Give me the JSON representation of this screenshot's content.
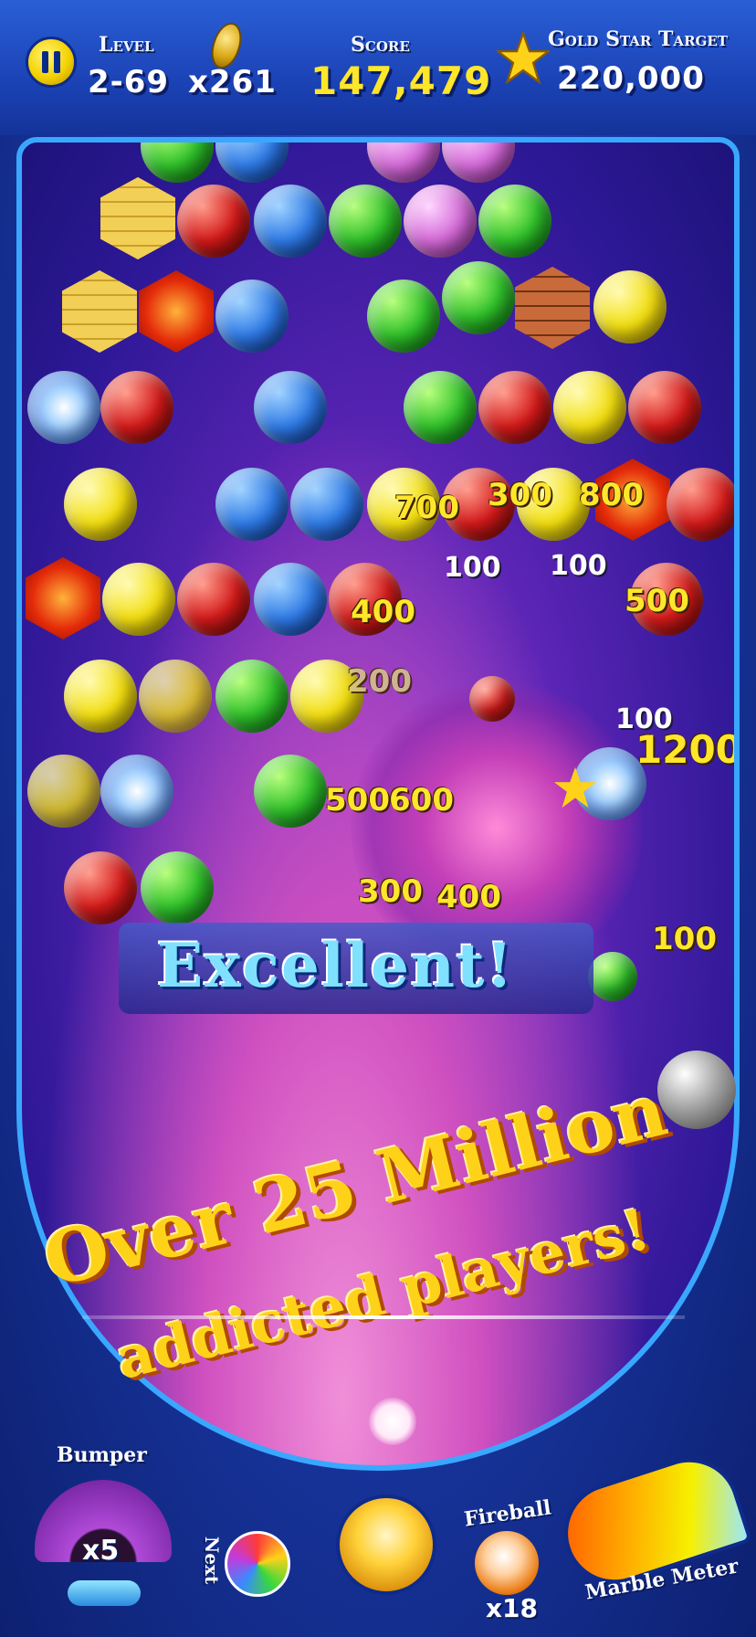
{
  "hud": {
    "level_label": "Level",
    "level_value": "2-69",
    "coins_value": "x261",
    "score_label": "Score",
    "score_value": "147,479",
    "target_label": "Gold Star Target",
    "target_value": "220,000"
  },
  "field": {
    "score_pops": [
      "700",
      "300",
      "800",
      "100",
      "100",
      "400",
      "500",
      "200",
      "100",
      "1200",
      "500",
      "600",
      "300",
      "400",
      "100"
    ],
    "excellent_text": "Excellent!",
    "promo_line1": "Over 25 Million",
    "promo_line2": "addicted players!"
  },
  "controls": {
    "bumper_label": "Bumper",
    "bumper_count": "x5",
    "next_label": "Next",
    "fireball_label": "Fireball",
    "fireball_count": "x18",
    "meter_label": "Marble Meter"
  },
  "colors": {
    "accent_gold": "#ffe62b",
    "frame_blue": "#1b43b6",
    "field_purple": "#5a24b4"
  },
  "icons": [
    "pause-icon",
    "coin-icon",
    "star-icon",
    "next-ball-icon",
    "fireball-icon"
  ]
}
